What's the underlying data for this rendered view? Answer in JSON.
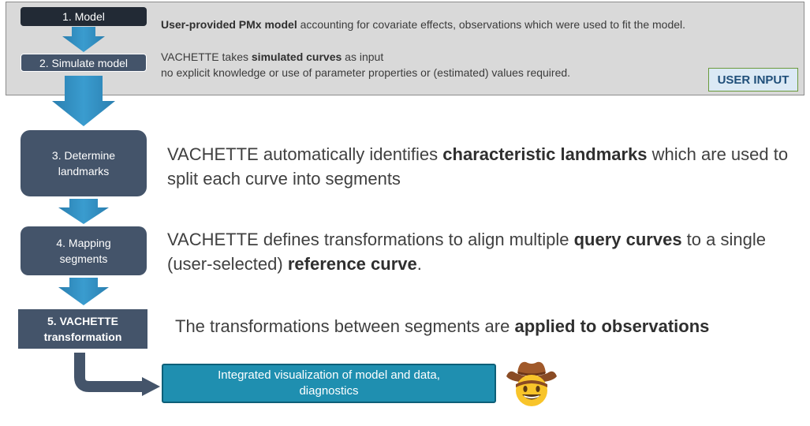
{
  "steps": {
    "s1": "1. Model",
    "s2": "2. Simulate model",
    "s3": "3. Determine\nlandmarks",
    "s4": "4. Mapping\nsegments",
    "s5": "5. VACHETTE\ntransformation"
  },
  "input_panel": {
    "line1_bold": "User-provided PMx model",
    "line1_rest": " accounting for covariate effects, observations which were used to fit the model.",
    "line2_pre": "VACHETTE takes ",
    "line2_bold": "simulated curves",
    "line2_rest": " as input",
    "line3": "no explicit knowledge or use of parameter properties or (estimated) values required.",
    "badge": "USER INPUT"
  },
  "descriptions": {
    "d3_pre": "VACHETTE automatically identifies ",
    "d3_bold": "characteristic landmarks",
    "d3_rest": " which are used to split each curve into segments",
    "d4_pre": "VACHETTE defines transformations to align multiple ",
    "d4_bold1": "query curves",
    "d4_mid": " to a single (user-selected) ",
    "d4_bold2": "reference curve",
    "d4_end": ".",
    "d5_pre": "The transformations between segments are ",
    "d5_bold": "applied to observations"
  },
  "output": {
    "label": "Integrated visualization of model and data,\ndiagnostics"
  },
  "colors": {
    "arrow": "#2e86b5",
    "step_box": "#44546a",
    "panel": "#d9d9d9",
    "output_box": "#1f8fb0"
  },
  "icons": {
    "emoji": "cowboy-face-icon"
  }
}
